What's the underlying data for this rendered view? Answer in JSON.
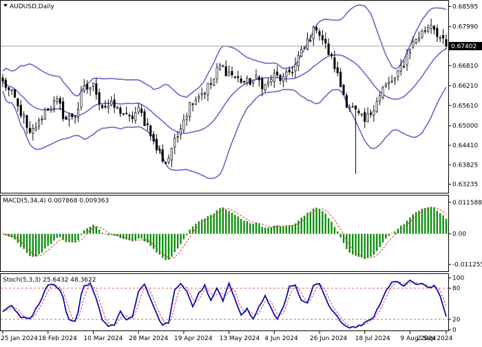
{
  "chart_data": {
    "type": "candlestick",
    "symbol_label": "AUDUSD,Daily",
    "current_price_label": "0.67402",
    "current_price": 0.67402,
    "colors": {
      "candle": "#000000",
      "bollinger": "#6a62c8",
      "price_line": "#a0a0a0",
      "macd_hist": "#0a8f0a",
      "macd_signal": "#d23b3b",
      "stoch_main": "#0a0aa8",
      "stoch_signal": "#d23b3b",
      "level_line": "#c83030"
    },
    "main_panel": {
      "ylim": [
        0.63,
        0.6875
      ],
      "yticks": [
        0.63235,
        0.63825,
        0.6441,
        0.65,
        0.6561,
        0.6621,
        0.6681,
        0.67402,
        0.6799,
        0.68595
      ],
      "ytick_labels": [
        "0.63235",
        "0.63825",
        "0.64410",
        "0.65000",
        "0.65610",
        "0.66210",
        "0.66810",
        "0.67402",
        "0.67990",
        "0.68595"
      ],
      "close_series_anchors": [
        [
          0,
          0.663
        ],
        [
          3,
          0.6595
        ],
        [
          6,
          0.654
        ],
        [
          9,
          0.647
        ],
        [
          11,
          0.65
        ],
        [
          15,
          0.6555
        ],
        [
          18,
          0.657
        ],
        [
          21,
          0.652
        ],
        [
          24,
          0.6535
        ],
        [
          27,
          0.661
        ],
        [
          30,
          0.662
        ],
        [
          33,
          0.656
        ],
        [
          36,
          0.656
        ],
        [
          39,
          0.6545
        ],
        [
          42,
          0.652
        ],
        [
          45,
          0.6545
        ],
        [
          48,
          0.65
        ],
        [
          51,
          0.643
        ],
        [
          54,
          0.639
        ],
        [
          57,
          0.645
        ],
        [
          60,
          0.6525
        ],
        [
          63,
          0.658
        ],
        [
          66,
          0.66
        ],
        [
          69,
          0.6625
        ],
        [
          72,
          0.668
        ],
        [
          75,
          0.666
        ],
        [
          78,
          0.664
        ],
        [
          81,
          0.663
        ],
        [
          84,
          0.664
        ],
        [
          87,
          0.662
        ],
        [
          90,
          0.665
        ],
        [
          93,
          0.664
        ],
        [
          96,
          0.667
        ],
        [
          99,
          0.672
        ],
        [
          102,
          0.677
        ],
        [
          104,
          0.68
        ],
        [
          106,
          0.676
        ],
        [
          108,
          0.672
        ],
        [
          110,
          0.668
        ],
        [
          112,
          0.662
        ],
        [
          114,
          0.657
        ],
        [
          116,
          0.655
        ],
        [
          118,
          0.653
        ],
        [
          120,
          0.651
        ],
        [
          122,
          0.654
        ],
        [
          124,
          0.658
        ],
        [
          127,
          0.662
        ],
        [
          130,
          0.664
        ],
        [
          133,
          0.669
        ],
        [
          135,
          0.674
        ],
        [
          138,
          0.677
        ],
        [
          140,
          0.679
        ],
        [
          142,
          0.681
        ],
        [
          144,
          0.678
        ],
        [
          146,
          0.675
        ],
        [
          147,
          0.67402
        ]
      ]
    },
    "macd_panel": {
      "label": "MACD(5,34,4) 0.007868 0.009363",
      "ylim": [
        -0.0135,
        0.0138
      ],
      "yticks": [
        0.011588,
        0.0,
        -0.011255
      ],
      "ytick_labels": [
        "0.011588",
        "0.00",
        "-0.011255"
      ]
    },
    "stoch_panel": {
      "label": "Stoch(5,3,3) 25.6432 48.3622",
      "ylim": [
        0,
        106
      ],
      "levels": [
        80,
        20
      ],
      "ytick_labels": [
        "100",
        "80",
        "20",
        "0"
      ],
      "main_anchors": [
        [
          0,
          35
        ],
        [
          3,
          45
        ],
        [
          6,
          25
        ],
        [
          9,
          20
        ],
        [
          12,
          50
        ],
        [
          15,
          85
        ],
        [
          17,
          88
        ],
        [
          19,
          75
        ],
        [
          22,
          20
        ],
        [
          24,
          15
        ],
        [
          27,
          85
        ],
        [
          29,
          88
        ],
        [
          31,
          60
        ],
        [
          33,
          20
        ],
        [
          35,
          5
        ],
        [
          37,
          10
        ],
        [
          39,
          35
        ],
        [
          41,
          20
        ],
        [
          43,
          25
        ],
        [
          45,
          75
        ],
        [
          47,
          88
        ],
        [
          49,
          60
        ],
        [
          51,
          30
        ],
        [
          53,
          8
        ],
        [
          55,
          15
        ],
        [
          57,
          75
        ],
        [
          59,
          88
        ],
        [
          61,
          75
        ],
        [
          63,
          45
        ],
        [
          65,
          70
        ],
        [
          67,
          85
        ],
        [
          69,
          55
        ],
        [
          71,
          80
        ],
        [
          73,
          55
        ],
        [
          75,
          88
        ],
        [
          77,
          60
        ],
        [
          79,
          30
        ],
        [
          81,
          40
        ],
        [
          83,
          20
        ],
        [
          85,
          45
        ],
        [
          87,
          65
        ],
        [
          89,
          40
        ],
        [
          91,
          20
        ],
        [
          93,
          45
        ],
        [
          95,
          82
        ],
        [
          97,
          85
        ],
        [
          99,
          55
        ],
        [
          101,
          50
        ],
        [
          103,
          85
        ],
        [
          105,
          88
        ],
        [
          107,
          60
        ],
        [
          109,
          40
        ],
        [
          111,
          25
        ],
        [
          113,
          10
        ],
        [
          115,
          5
        ],
        [
          117,
          5
        ],
        [
          119,
          10
        ],
        [
          121,
          18
        ],
        [
          123,
          25
        ],
        [
          125,
          50
        ],
        [
          127,
          75
        ],
        [
          129,
          92
        ],
        [
          131,
          92
        ],
        [
          133,
          85
        ],
        [
          135,
          95
        ],
        [
          137,
          88
        ],
        [
          139,
          90
        ],
        [
          141,
          80
        ],
        [
          143,
          85
        ],
        [
          145,
          65
        ],
        [
          147,
          25.6432
        ]
      ]
    },
    "x_axis": {
      "bar_count": 148,
      "tick_bars": [
        0,
        15,
        30,
        45,
        60,
        75,
        90,
        105,
        120,
        135,
        148
      ],
      "tick_labels": [
        "25 Jan 2024",
        "16 Feb 2024",
        "10 Mar 2024",
        "28 Mar 2024",
        "19 Apr 2024",
        "13 May 2024",
        "4 Jun 2024",
        "26 Jun 2024",
        "18 Jul 2024",
        "9 Aug 2024",
        "2 Sep 2024"
      ]
    }
  }
}
